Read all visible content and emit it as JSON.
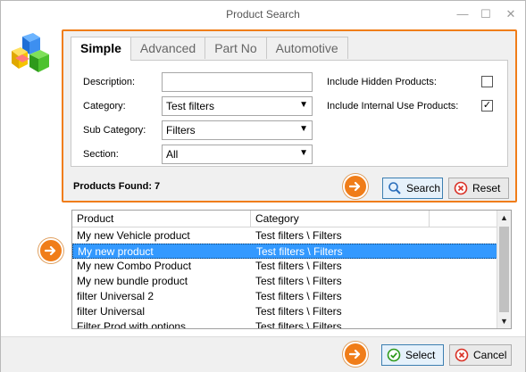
{
  "window": {
    "title": "Product Search",
    "controls": [
      "minimize-icon",
      "maximize-icon",
      "close-icon"
    ]
  },
  "tabs": [
    {
      "label": "Simple",
      "active": true
    },
    {
      "label": "Advanced",
      "active": false
    },
    {
      "label": "Part No",
      "active": false
    },
    {
      "label": "Automotive",
      "active": false
    }
  ],
  "form": {
    "description_label": "Description:",
    "description_value": "",
    "category_label": "Category:",
    "category_value": "Test filters",
    "subcategory_label": "Sub Category:",
    "subcategory_value": "Filters",
    "section_label": "Section:",
    "section_value": "All",
    "include_hidden_label": "Include Hidden Products:",
    "include_hidden_checked": false,
    "include_internal_label": "Include Internal Use Products:",
    "include_internal_checked": true,
    "internal_check_glyph": "✓"
  },
  "products_found": "Products Found: 7",
  "buttons": {
    "search": "Search",
    "reset": "Reset",
    "select": "Select",
    "cancel": "Cancel"
  },
  "grid": {
    "columns": [
      "Product",
      "Category"
    ],
    "rows": [
      {
        "product": "My new Vehicle product",
        "category": "Test filters \\ Filters"
      },
      {
        "product": "My new product",
        "category": "Test filters \\ Filters",
        "selected": true
      },
      {
        "product": "My new Combo Product",
        "category": "Test filters \\ Filters"
      },
      {
        "product": "My new bundle product",
        "category": "Test filters \\ Filters"
      },
      {
        "product": "filter Universal 2",
        "category": "Test filters \\ Filters"
      },
      {
        "product": "filter Universal",
        "category": "Test filters \\ Filters"
      },
      {
        "product": "Filter Prod with options",
        "category": "Test filters \\ Filters"
      }
    ]
  },
  "colors": {
    "highlight_orange": "#f07d19",
    "selection_blue": "#3399ff"
  }
}
